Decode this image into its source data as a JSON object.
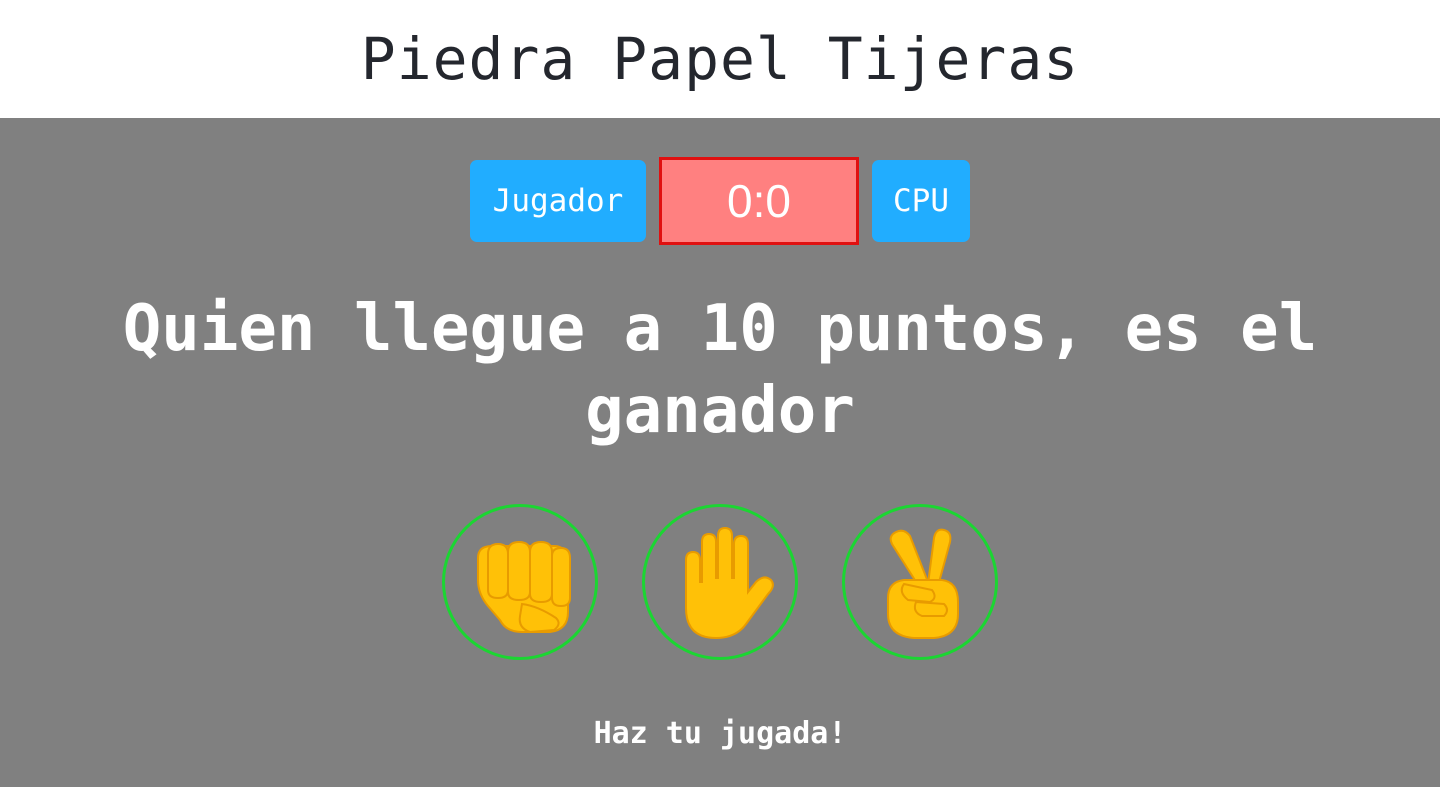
{
  "header": {
    "title": "Piedra Papel Tijeras"
  },
  "scoreboard": {
    "player_label": "Jugador",
    "score": "0:0",
    "cpu_label": "CPU",
    "colors": {
      "badge": "#21adff",
      "score_bg": "#ff8080",
      "score_border": "#e01010"
    }
  },
  "message": {
    "rule": "Quien llegue a 10 puntos, es el ganador",
    "prompt": "Haz tu jugada!"
  },
  "choices": [
    {
      "icon": "rock-fist-icon"
    },
    {
      "icon": "paper-hand-icon"
    },
    {
      "icon": "scissors-victory-icon"
    }
  ],
  "colors": {
    "stage_bg": "#808080",
    "choice_ring": "#1bd632",
    "emoji_yellow": "#ffc107"
  }
}
